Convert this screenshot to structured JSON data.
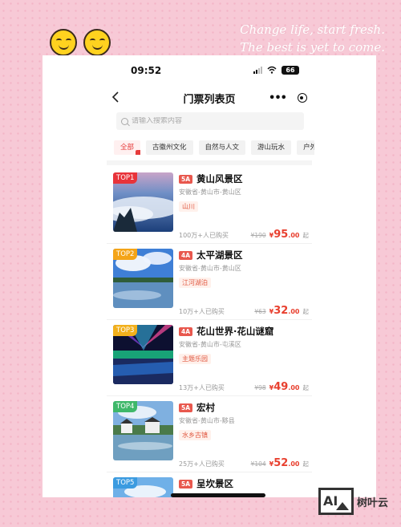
{
  "tagline": {
    "line1": "Change life, start fresh.",
    "line2": "The best is yet to come."
  },
  "status_bar": {
    "time": "09:52",
    "battery": "66"
  },
  "nav": {
    "title": "门票列表页"
  },
  "search": {
    "placeholder": "请输入搜索内容"
  },
  "tabs": [
    {
      "label": "全部",
      "active": true
    },
    {
      "label": "古徽州文化",
      "active": false
    },
    {
      "label": "自然与人文",
      "active": false
    },
    {
      "label": "游山玩水",
      "active": false
    },
    {
      "label": "户外",
      "active": false
    }
  ],
  "colors": {
    "accent": "#e8402f",
    "rank_top1": "#e8333a",
    "rank_top2": "#f4a418",
    "rank_top3": "#f2b01c",
    "rank_top4": "#3fb86a",
    "rank_top5": "#3b9be0"
  },
  "list": [
    {
      "rank": "TOP1",
      "grade": "5A",
      "name": "黄山风景区",
      "location": "安徽省-黄山市-黄山区",
      "tag": "山川",
      "sold": "100万+人已购买",
      "orig_price": "¥190",
      "price_yen": "¥",
      "price_int": "95",
      "price_dec": ".00",
      "price_suffix": "起"
    },
    {
      "rank": "TOP2",
      "grade": "4A",
      "name": "太平湖景区",
      "location": "安徽省-黄山市-黄山区",
      "tag": "江河湖泊",
      "sold": "10万+人已购买",
      "orig_price": "¥63",
      "price_yen": "¥",
      "price_int": "32",
      "price_dec": ".00",
      "price_suffix": "起"
    },
    {
      "rank": "TOP3",
      "grade": "4A",
      "name": "花山世界·花山谜窟",
      "location": "安徽省-黄山市-屯溪区",
      "tag": "主题乐园",
      "sold": "13万+人已购买",
      "orig_price": "¥98",
      "price_yen": "¥",
      "price_int": "49",
      "price_dec": ".00",
      "price_suffix": "起"
    },
    {
      "rank": "TOP4",
      "grade": "5A",
      "name": "宏村",
      "location": "安徽省-黄山市-黟县",
      "tag": "水乡古镇",
      "sold": "25万+人已购买",
      "orig_price": "¥104",
      "price_yen": "¥",
      "price_int": "52",
      "price_dec": ".00",
      "price_suffix": "起"
    },
    {
      "rank": "TOP5",
      "grade": "5A",
      "name": "呈坎景区"
    }
  ],
  "icons": {
    "back": "chevron-left-icon",
    "more": "more-dots-icon",
    "close": "capsule-close-icon",
    "search": "search-icon"
  },
  "watermark": {
    "logo_text": "AI",
    "name": "树叶云"
  }
}
